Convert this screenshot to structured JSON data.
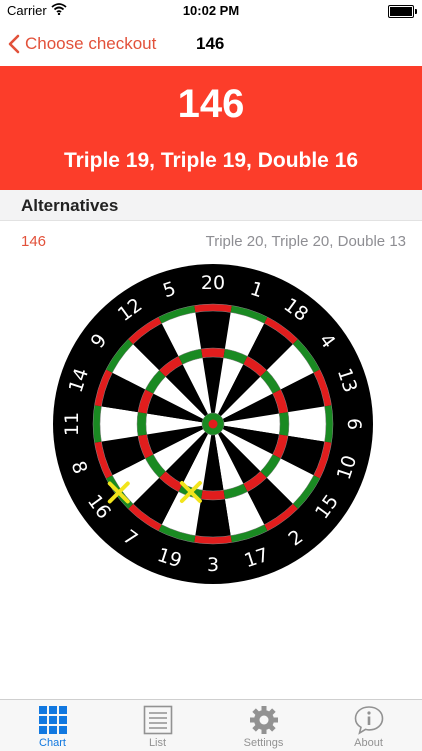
{
  "status_bar": {
    "carrier": "Carrier",
    "time": "10:02 PM"
  },
  "nav": {
    "back_label": "Choose checkout",
    "title": "146"
  },
  "hero": {
    "score": "146",
    "combination": "Triple 19, Triple 19, Double 16"
  },
  "alternatives": {
    "header": "Alternatives",
    "items": [
      {
        "score": "146",
        "combination": "Triple 20, Triple 20, Double 13"
      }
    ]
  },
  "dartboard": {
    "numbers": [
      "20",
      "1",
      "18",
      "4",
      "13",
      "6",
      "10",
      "15",
      "2",
      "17",
      "3",
      "19",
      "7",
      "16",
      "8",
      "11",
      "14",
      "9",
      "12",
      "5"
    ],
    "highlighted_targets": [
      "Triple 19",
      "Double 16"
    ],
    "colors": {
      "ring_red": "#e11d1d",
      "ring_green": "#1a8a22",
      "marker": "#f2e41c",
      "board": "#000000"
    }
  },
  "tabs": [
    {
      "label": "Chart",
      "icon": "grid-icon",
      "active": true
    },
    {
      "label": "List",
      "icon": "list-icon",
      "active": false
    },
    {
      "label": "Settings",
      "icon": "gear-icon",
      "active": false
    },
    {
      "label": "About",
      "icon": "info-bubble-icon",
      "active": false
    }
  ],
  "colors": {
    "accent": "#fc3d2a",
    "tab_active": "#1178e0",
    "tab_inactive": "#929292"
  }
}
